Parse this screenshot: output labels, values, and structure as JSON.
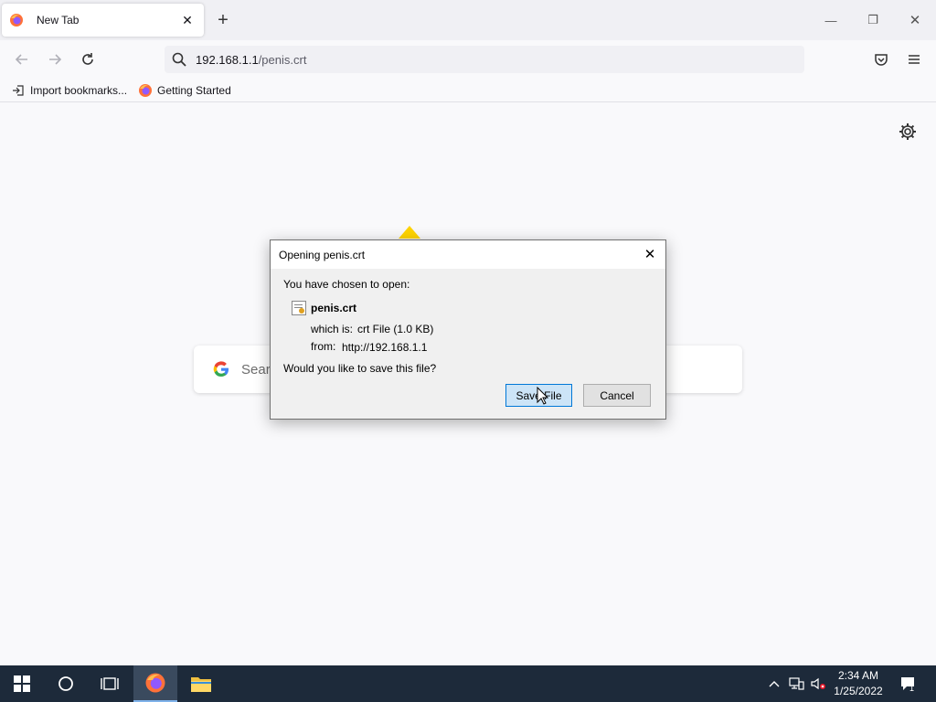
{
  "tab": {
    "title": "New Tab",
    "close_glyph": "✕"
  },
  "newtab": {
    "glyph": "+"
  },
  "window": {
    "minimize": "—",
    "restore": "❐",
    "close": "✕"
  },
  "urlbar": {
    "host": "192.168.1.1",
    "path": "/penis.crt"
  },
  "bookmarks": [
    {
      "label": "Import bookmarks...",
      "icon": "import-icon"
    },
    {
      "label": "Getting Started",
      "icon": "firefox-icon"
    }
  ],
  "search": {
    "placeholder": "Sear"
  },
  "dialog": {
    "title": "Opening penis.crt",
    "intro": "You have chosen to open:",
    "filename": "penis.crt",
    "which_is_label": "which is:",
    "which_is_value": "crt File (1.0 KB)",
    "from_label": "from:",
    "from_value": "http://192.168.1.1",
    "question": "Would you like to save this file?",
    "save_label": "Save File",
    "cancel_label": "Cancel"
  },
  "taskbar": {
    "time": "2:34 AM",
    "date": "1/25/2022",
    "notification_count": "1"
  },
  "colors": {
    "accent": "#0078d7",
    "taskbar": "#1d2a3a",
    "firefox_orange": "#ff7139"
  }
}
